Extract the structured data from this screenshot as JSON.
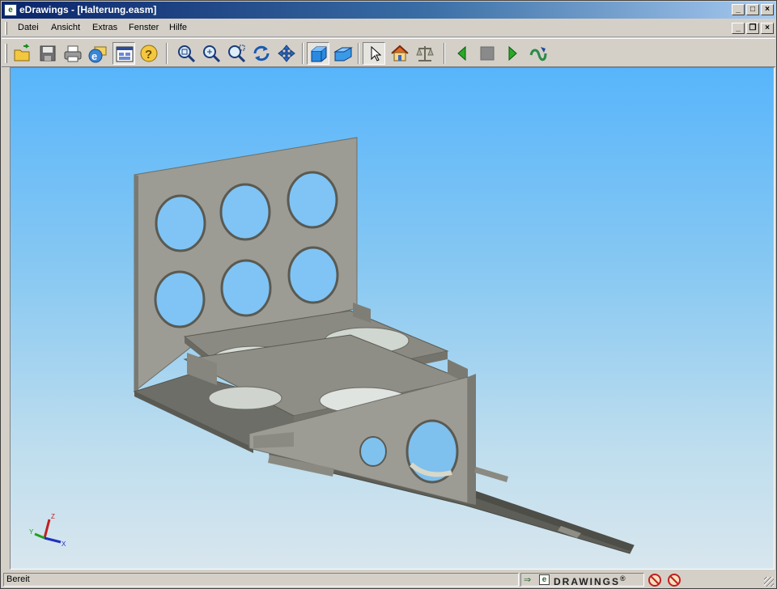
{
  "window": {
    "title": "eDrawings - [Halterung.easm]",
    "app_icon_letter": "e",
    "caption_buttons": [
      "minimize",
      "maximize",
      "close"
    ]
  },
  "menu": {
    "items": [
      "Datei",
      "Ansicht",
      "Extras",
      "Fenster",
      "Hilfe"
    ],
    "mdi_buttons": [
      "minimize",
      "restore",
      "close"
    ]
  },
  "toolbar": {
    "buttons": [
      {
        "name": "open-icon"
      },
      {
        "name": "save-icon"
      },
      {
        "name": "print-icon"
      },
      {
        "name": "send-email-icon"
      },
      {
        "name": "tiled-windows-icon",
        "pressed": true
      },
      {
        "name": "help-icon"
      },
      {
        "name": "zoom-fit-icon"
      },
      {
        "name": "zoom-icon"
      },
      {
        "name": "zoom-area-icon"
      },
      {
        "name": "rotate-icon"
      },
      {
        "name": "pan-icon"
      },
      {
        "name": "shaded-icon",
        "pressed": true
      },
      {
        "name": "perspective-icon"
      },
      {
        "name": "select-icon",
        "pressed": true
      },
      {
        "name": "home-icon"
      },
      {
        "name": "measure-icon"
      },
      {
        "name": "play-previous-icon"
      },
      {
        "name": "stop-icon"
      },
      {
        "name": "play-next-icon"
      },
      {
        "name": "continuous-play-icon"
      }
    ]
  },
  "viewport": {
    "model_name": "Halterung",
    "triad_axes": [
      "Z",
      "Y",
      "X"
    ]
  },
  "status": {
    "text": "Bereit",
    "brand": "DRAWINGS",
    "brand_mark": "®",
    "brand_icon_letter": "e"
  },
  "colors": {
    "title_gradient_start": "#0a246a",
    "title_gradient_end": "#a6caf0",
    "viewport_top": "#58b5fb",
    "viewport_bottom": "#d8e6ee",
    "part_gray": "#8e8e86"
  }
}
